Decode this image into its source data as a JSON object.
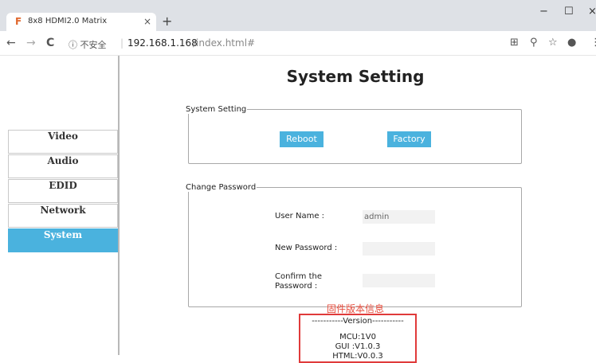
{
  "browser": {
    "tab_favicon": "F",
    "tab_title": "8x8 HDMI2.0 Matrix",
    "tab_close": "×",
    "new_tab": "+",
    "window_controls": {
      "minimize": "−",
      "maximize": "☐",
      "close": "×"
    },
    "back": "←",
    "forward": "→",
    "reload": "C",
    "security_text": "ⓘ 不安全",
    "url_host": "192.168.1.168",
    "url_path": "/index.html#",
    "toolbar_icons": [
      "translate-icon",
      "zoom-icon",
      "star-icon",
      "profile-icon"
    ]
  },
  "page": {
    "title": "System Setting",
    "sidebar": {
      "items": [
        {
          "label": "Video",
          "active": false
        },
        {
          "label": "Audio",
          "active": false
        },
        {
          "label": "EDID",
          "active": false
        },
        {
          "label": "Network",
          "active": false
        },
        {
          "label": "System",
          "active": true
        }
      ]
    },
    "system_setting": {
      "legend": "System Setting",
      "reboot_label": "Reboot",
      "factory_label": "Factory"
    },
    "change_password": {
      "legend": "Change Password",
      "username_label": "User Name :",
      "username_value": "admin",
      "new_password_label": "New Password :",
      "new_password_value": "",
      "confirm_label_line1": "Confirm the",
      "confirm_label_line2": "Password :",
      "confirm_value": ""
    },
    "annotation": "固件版本信息",
    "version": {
      "header": "-----------Version-----------",
      "mcu": "MCU:1V0",
      "gui": "GUI :V1.0.3",
      "html": "HTML:V0.0.3"
    }
  },
  "colors": {
    "accent": "#4ab2de",
    "annotation_red": "#e74c3c",
    "chrome_bg": "#dee1e6"
  }
}
